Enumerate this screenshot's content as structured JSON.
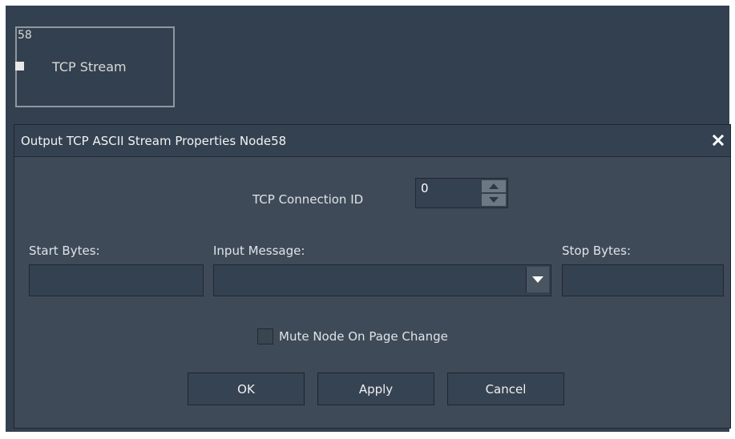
{
  "node": {
    "id": "58",
    "title": "TCP Stream"
  },
  "dialog": {
    "title": "Output TCP ASCII Stream Properties Node58",
    "close_icon": "close-icon",
    "connection": {
      "label": "TCP Connection ID",
      "value": "0"
    },
    "start_bytes": {
      "label": "Start Bytes:",
      "value": ""
    },
    "input_message": {
      "label": "Input Message:",
      "value": ""
    },
    "stop_bytes": {
      "label": "Stop Bytes:",
      "value": ""
    },
    "mute": {
      "label": "Mute Node On Page Change",
      "checked": false
    },
    "buttons": {
      "ok": "OK",
      "apply": "Apply",
      "cancel": "Cancel"
    }
  },
  "colors": {
    "canvas_bg": "#33404f",
    "dialog_bg": "#3f4a58",
    "field_bg": "#334151",
    "text": "#ebebeb"
  }
}
